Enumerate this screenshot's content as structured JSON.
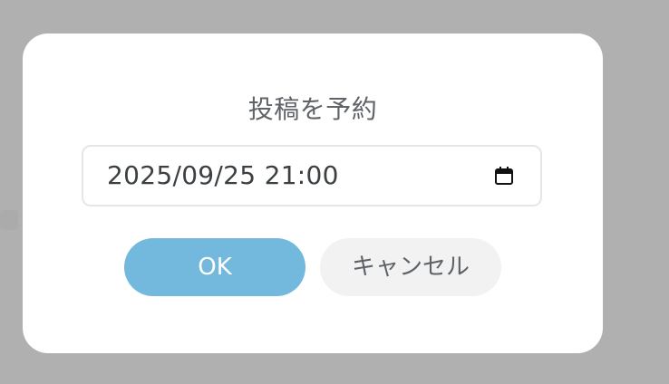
{
  "dialog": {
    "title": "投稿を予約",
    "datetime_value": "2025/09/25 21:00",
    "calendar_icon": "calendar-icon",
    "ok_label": "OK",
    "cancel_label": "キャンセル"
  },
  "colors": {
    "overlay": "#b0b0b0",
    "dialog_bg": "#ffffff",
    "ok_bg": "#73b8dd",
    "cancel_bg": "#f2f2f2",
    "text": "#5f6368"
  }
}
